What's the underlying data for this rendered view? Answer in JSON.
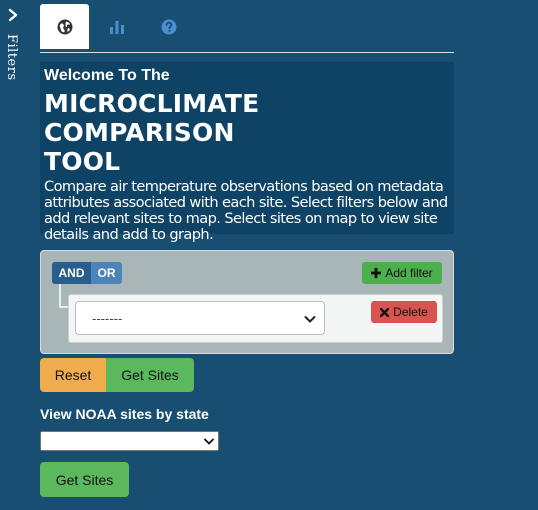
{
  "sidebar": {
    "label": "Filters",
    "toggle_icon": "chevron-right-icon"
  },
  "tabs": [
    {
      "icon": "globe-icon",
      "active": true
    },
    {
      "icon": "bar-chart-icon",
      "active": false
    },
    {
      "icon": "question-circle-icon",
      "active": false
    }
  ],
  "hero": {
    "welcome": "Welcome To The",
    "title_line1": "MICROCLIMATE COMPARISON",
    "title_line2": "TOOL",
    "description": "Compare air temperature observations based on metadata attributes associated with each site. Select filters below and add relevant sites to map. Select sites on map to view site details and add to graph."
  },
  "filter_builder": {
    "and_label": "AND",
    "or_label": "OR",
    "add_filter_label": "Add filter",
    "rule_select_value": "-------",
    "delete_label": "Delete"
  },
  "actions": {
    "reset_label": "Reset",
    "get_sites_label": "Get Sites"
  },
  "noaa": {
    "label": "View NOAA sites by state",
    "state_value": "",
    "get_sites_label": "Get Sites"
  },
  "colors": {
    "background": "#174e72",
    "hero_bg": "#0e4365",
    "primary": "#285e8e",
    "success": "#5cb85c",
    "warning": "#f0ad4e",
    "danger": "#d9534f"
  }
}
